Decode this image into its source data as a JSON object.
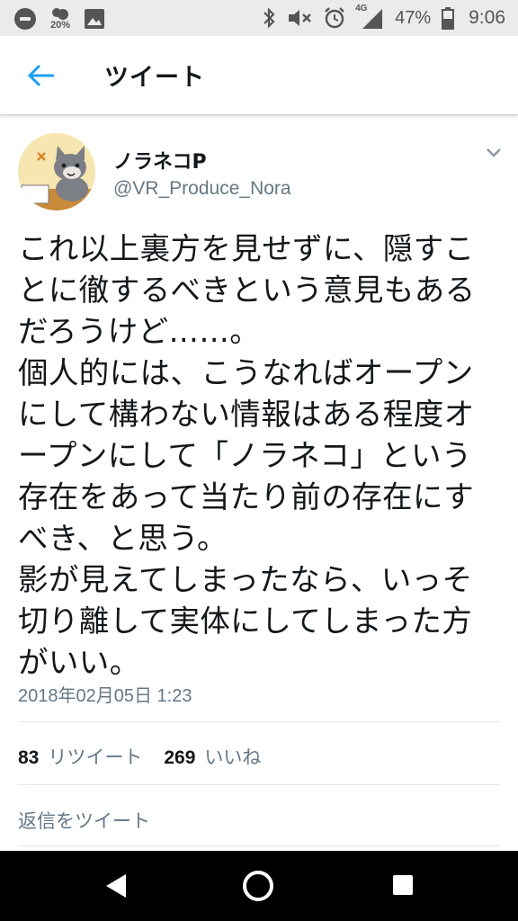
{
  "status_bar": {
    "temperature": "20%",
    "network": "4G",
    "battery": "47%",
    "time": "9:06",
    "icons": [
      "do-not-disturb-icon",
      "weather-icon",
      "photo-icon",
      "bluetooth-icon",
      "mute-icon",
      "alarm-icon",
      "signal-icon",
      "battery-icon"
    ]
  },
  "header": {
    "title": "ツイート"
  },
  "tweet": {
    "display_name": "ノラネコP",
    "username": "@VR_Produce_Nora",
    "text": "これ以上裏方を見せずに、隠すことに徹するべきという意見もあるだろうけど……。\n個人的には、こうなればオープンにして構わない情報はある程度オープンにして「ノラネコ」という存在をあって当たり前の存在にすべき、と思う。\n影が見えてしまったなら、いっそ切り離して実体にしてしまった方がいい。",
    "timestamp": "2018年02月05日 1:23",
    "retweet_count": "83",
    "retweet_label": "リツイート",
    "like_count": "269",
    "like_label": "いいね",
    "reply_placeholder": "返信をツイート",
    "accent_color": "#1da1f2"
  }
}
